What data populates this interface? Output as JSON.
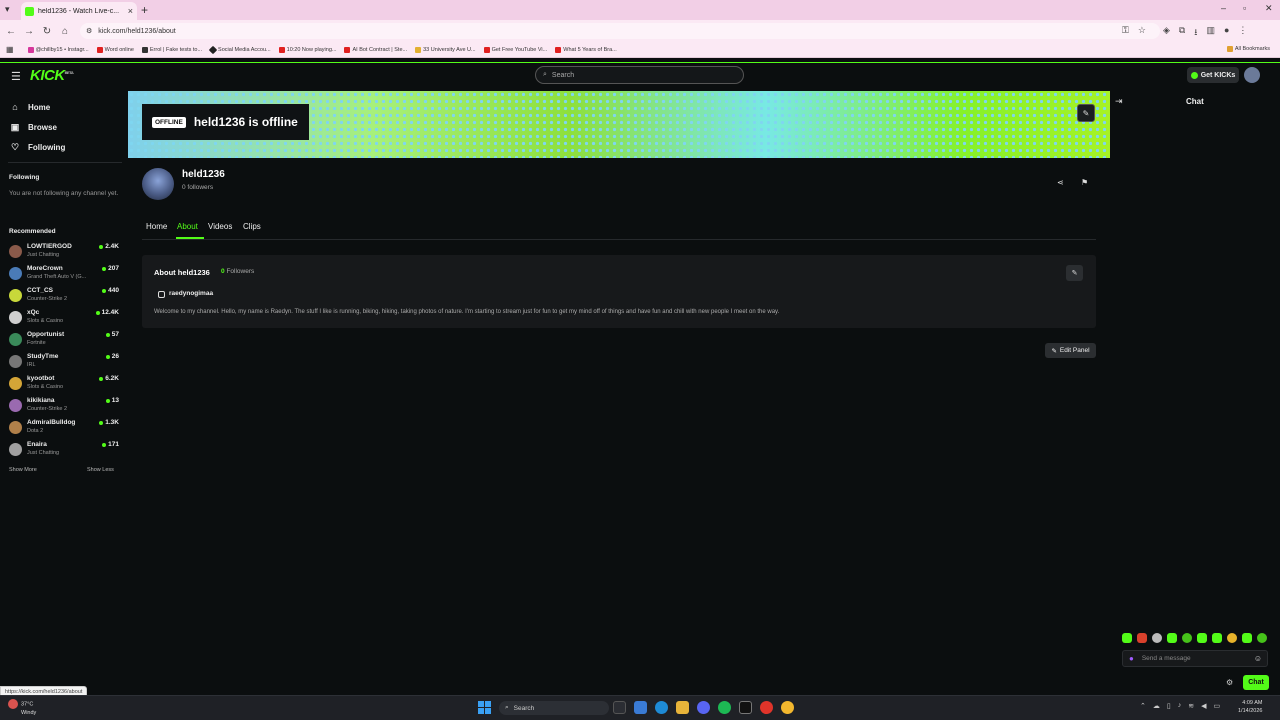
{
  "browser": {
    "tab_title": "held1236 - Watch Live-c...",
    "url": "kick.com/held1236/about",
    "bookmarks": [
      "@chillby15 • Instagr...",
      "Word online",
      "Errol | Fake tests to...",
      "Social Media Accou...",
      "10:20 Now playing...",
      "AI Bot Contract | Ste...",
      "33 University Ave U...",
      "Get Free YouTube Vi...",
      "What 5 Years of Bra..."
    ],
    "all_bookmarks": "All Bookmarks",
    "status_url": "https://kick.com/held1236/about"
  },
  "header": {
    "logo": "KICK",
    "logo_badge": "BETA",
    "search_placeholder": "Search",
    "get_kicks": "Get KICKs"
  },
  "sidebar": {
    "nav": [
      {
        "label": "Home",
        "icon": "home-icon"
      },
      {
        "label": "Browse",
        "icon": "browse-icon"
      },
      {
        "label": "Following",
        "icon": "heart-icon"
      }
    ],
    "following_title": "Following",
    "not_following": "You are not following any channel yet.",
    "recommended_title": "Recommended",
    "recommended": [
      {
        "name": "LOWTIERGOD",
        "category": "Just Chatting",
        "viewers": "2.4K",
        "color": "#8a5a4a"
      },
      {
        "name": "MoreCrown",
        "category": "Grand Theft Auto V (G...",
        "viewers": "207",
        "color": "#4a7bb7"
      },
      {
        "name": "CCT_CS",
        "category": "Counter-Strike 2",
        "viewers": "440",
        "color": "#c8d83a"
      },
      {
        "name": "xQc",
        "category": "Slots & Casino",
        "viewers": "12.4K",
        "color": "#cfcfcf"
      },
      {
        "name": "Opportunist",
        "category": "Fortnite",
        "viewers": "57",
        "color": "#3a8a5a"
      },
      {
        "name": "StudyTme",
        "category": "IRL",
        "viewers": "26",
        "color": "#777777"
      },
      {
        "name": "kyootbot",
        "category": "Slots & Casino",
        "viewers": "6.2K",
        "color": "#d4a537"
      },
      {
        "name": "kikikiana",
        "category": "Counter-Strike 2",
        "viewers": "13",
        "color": "#9a6ab0"
      },
      {
        "name": "AdmiralBulldog",
        "category": "Dota 2",
        "viewers": "1.3K",
        "color": "#b0804a"
      },
      {
        "name": "Enaira",
        "category": "Just Chatting",
        "viewers": "171",
        "color": "#a0a0a0"
      }
    ],
    "show_more": "Show More",
    "show_less": "Show Less"
  },
  "banner": {
    "offline_badge": "OFFLINE",
    "offline_title": "held1236 is offline"
  },
  "profile": {
    "username": "held1236",
    "followers": "0 followers",
    "tabs": [
      "Home",
      "About",
      "Videos",
      "Clips"
    ],
    "active_tab": "About"
  },
  "about": {
    "title": "About held1236",
    "followers_count": "0",
    "followers_label": "Followers",
    "instagram": "raedynogimaa",
    "bio": "Welcome to my channel. Hello, my name is Raedyn. The stuff I like is running, biking, hiking, taking photos of nature. I'm starting to stream just for fun to get my mind off of things and have fun and chill with new people I meet on the way.",
    "edit_panel": "Edit Panel"
  },
  "chat": {
    "title": "Chat",
    "placeholder": "Send a message",
    "send_label": "Chat"
  },
  "taskbar": {
    "temperature": "37°C",
    "weather": "Windy",
    "search": "Search",
    "time": "4:09 AM",
    "date": "1/14/2026"
  },
  "colors": {
    "accent": "#53fc18",
    "background": "#0b0e0f",
    "panel": "#17191b"
  }
}
